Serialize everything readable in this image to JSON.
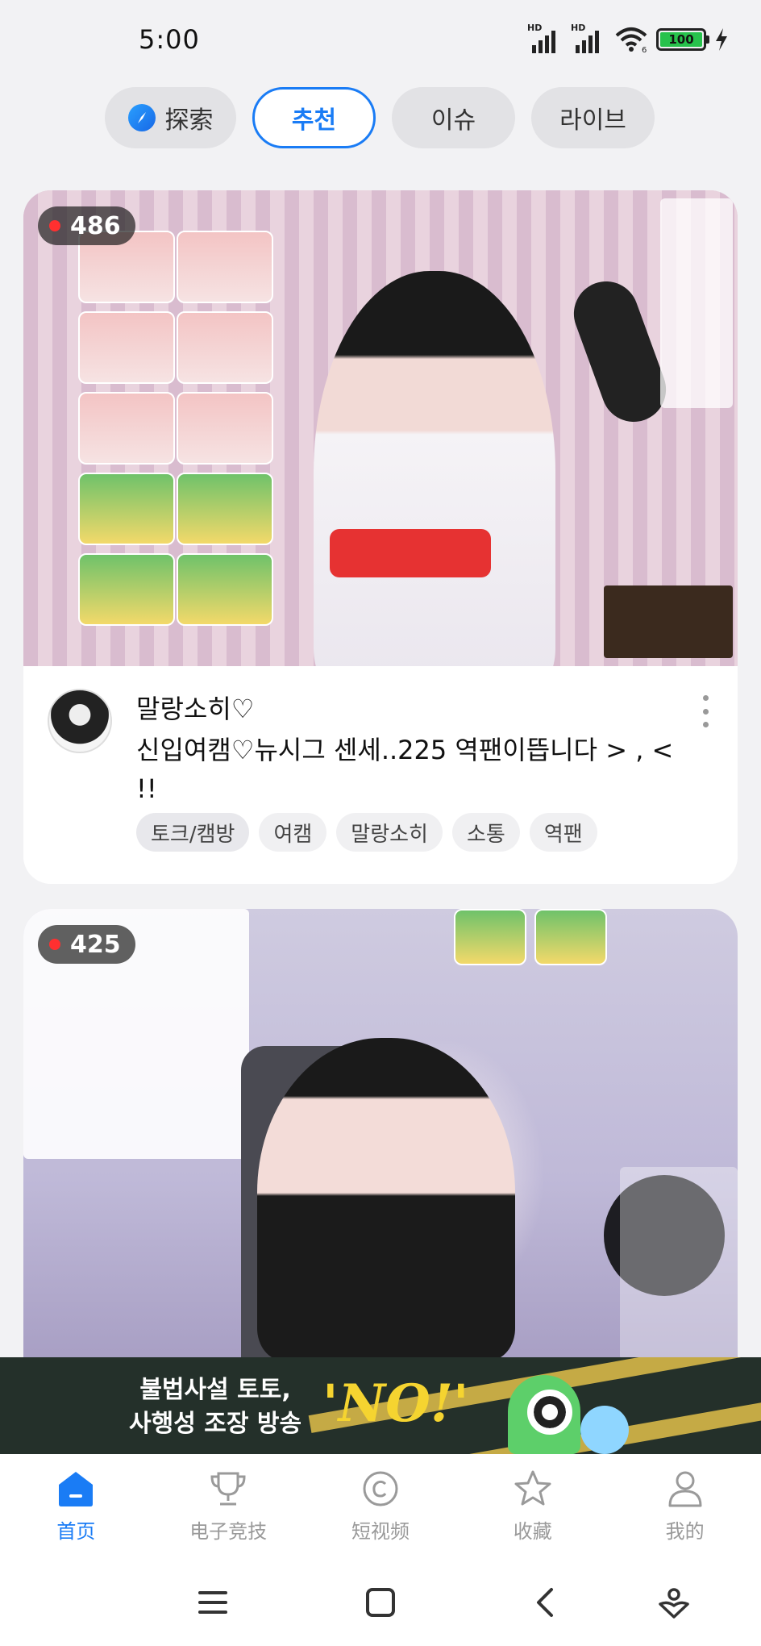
{
  "status_bar": {
    "time": "5:00",
    "signal_1_label": "HD",
    "signal_2_label": "HD",
    "wifi_badge": "6",
    "battery": "100"
  },
  "top_tabs": [
    {
      "label": "探索",
      "icon": "compass-icon",
      "active": false
    },
    {
      "label": "추천",
      "active": true
    },
    {
      "label": "이슈",
      "active": false
    },
    {
      "label": "라이브",
      "active": false
    }
  ],
  "cards": [
    {
      "viewer_count": "486",
      "streamer_name": "말랑소히♡",
      "title": "신입여캠♡뉴시그 센세..225 역팬이뜹니다 > , < !!",
      "tags": [
        "토크/캠방",
        "여캠",
        "말랑소히",
        "소통",
        "역팬"
      ]
    },
    {
      "viewer_count": "425"
    }
  ],
  "banner": {
    "line1": "불법사설 토토,",
    "line2": "사행성 조장 방송",
    "slogan": "'NO!'"
  },
  "bottom_nav": [
    {
      "label": "首页",
      "icon": "home-icon",
      "active": true
    },
    {
      "label": "电子竞技",
      "icon": "trophy-icon",
      "active": false
    },
    {
      "label": "短视频",
      "icon": "short-video-icon",
      "active": false
    },
    {
      "label": "收藏",
      "icon": "star-icon",
      "active": false
    },
    {
      "label": "我的",
      "icon": "profile-icon",
      "active": false
    }
  ],
  "colors": {
    "accent": "#1a7cf5",
    "live_dot": "#ff3030",
    "banner_bg": "#24302a",
    "banner_slogan": "#f5d430"
  }
}
